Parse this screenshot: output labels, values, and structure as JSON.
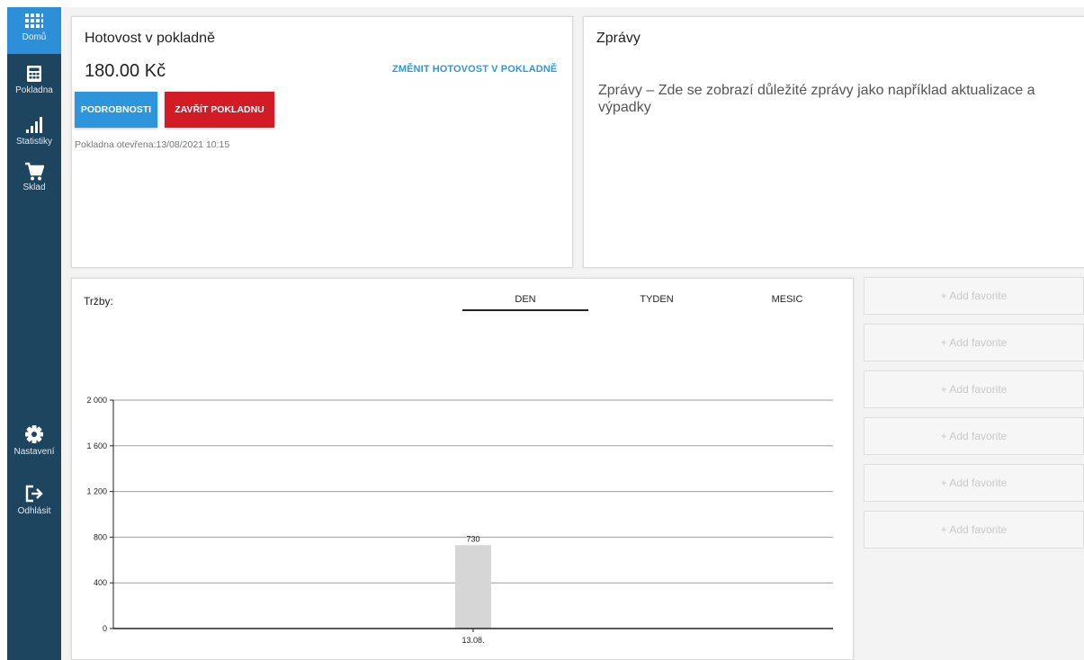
{
  "sidebar": {
    "items": [
      {
        "label": "Domů",
        "icon": "grid-icon"
      },
      {
        "label": "Pokladna",
        "icon": "calculator-icon"
      },
      {
        "label": "Statistiky",
        "icon": "signal-bars-icon"
      },
      {
        "label": "Sklad",
        "icon": "cart-icon"
      },
      {
        "label": "Nastavení",
        "icon": "gear-icon"
      },
      {
        "label": "Odhlásit",
        "icon": "logout-icon"
      }
    ],
    "active_color": "#2c8fd8",
    "bg_color": "#1e4560"
  },
  "cash": {
    "title": "Hotovost v pokladně",
    "amount": "180.00 Kč",
    "change_label": "ZMĚNIT HOTOVOST V POKLADNĚ",
    "details_label": "PODROBNOSTI",
    "close_label": "ZAVŘÍT POKLADNU",
    "opened_text": "Pokladna otevřena:13/08/2021 10:15"
  },
  "messages": {
    "title": "Zprávy",
    "text": "Zprávy – Zde se zobrazí důležité zprávy jako například aktualizace a výpadky"
  },
  "sales": {
    "title": "Tržby:",
    "tabs": [
      {
        "label": "DEN",
        "active": true
      },
      {
        "label": "TYDEN",
        "active": false
      },
      {
        "label": "MESIC",
        "active": false
      }
    ]
  },
  "chart_data": {
    "type": "bar",
    "categories": [
      "13.08."
    ],
    "values": [
      730
    ],
    "data_labels": [
      "730"
    ],
    "ylim": [
      0,
      2000
    ],
    "yticks": [
      0,
      400,
      800,
      1200,
      1600,
      2000
    ],
    "ytick_labels": [
      "0",
      "400",
      "800",
      "1 200",
      "1 600",
      "2 000"
    ],
    "grid": true,
    "bar_color": "#d6d6d6"
  },
  "favorites": [
    {
      "label": "+ Add favorite"
    },
    {
      "label": "+ Add favorite"
    },
    {
      "label": "+ Add favorite"
    },
    {
      "label": "+ Add favorite"
    },
    {
      "label": "+ Add favorite"
    },
    {
      "label": "+ Add favorite"
    }
  ]
}
